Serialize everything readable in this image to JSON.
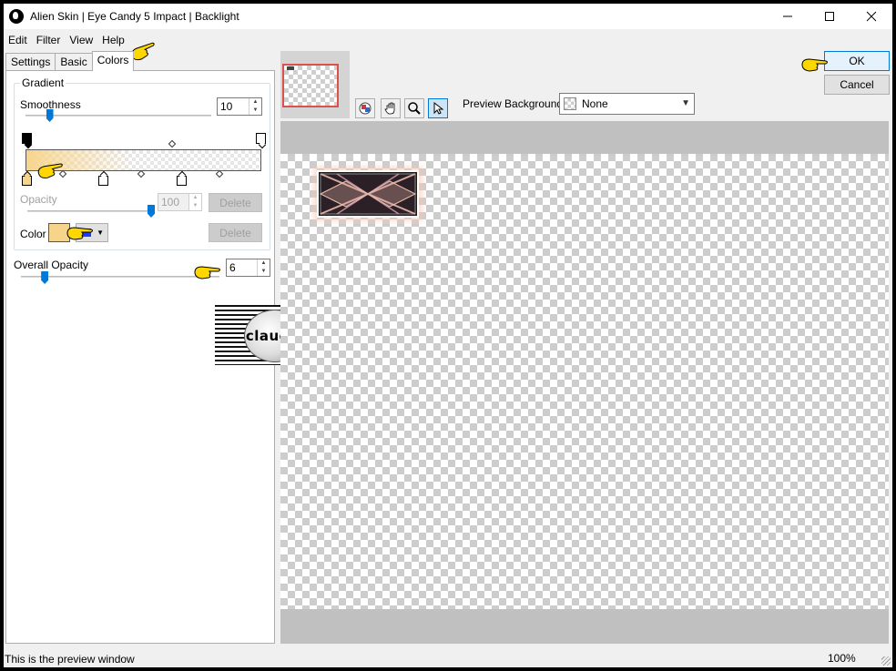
{
  "titlebar": {
    "title": "Alien Skin | Eye Candy 5 Impact | Backlight"
  },
  "menu": [
    "Edit",
    "Filter",
    "View",
    "Help"
  ],
  "tabs": [
    "Settings",
    "Basic",
    "Colors"
  ],
  "gradient": {
    "group_label": "Gradient",
    "smoothness_label": "Smoothness",
    "smoothness_value": "10",
    "smoothness_level": 0.1,
    "opacity_label": "Opacity",
    "opacity_value": "100",
    "opacity_level": 1.0,
    "delete_label": "Delete",
    "color_label": "Color",
    "color_delete_label": "Delete",
    "color_value": "#f7d48c",
    "secondary_color": "#1a3cff"
  },
  "overall_opacity": {
    "label": "Overall Opacity",
    "value": "6",
    "level": 0.06
  },
  "watermark": {
    "text": "claudia"
  },
  "buttons": {
    "ok": "OK",
    "cancel": "Cancel"
  },
  "preview_bg": {
    "label": "Preview Background:",
    "value": "None"
  },
  "status": {
    "text": "This is the preview window",
    "zoom": "100%"
  },
  "colors": {
    "accent": "#0078d7",
    "pointer": "#ffd700",
    "thumb_border": "#e0504a"
  }
}
